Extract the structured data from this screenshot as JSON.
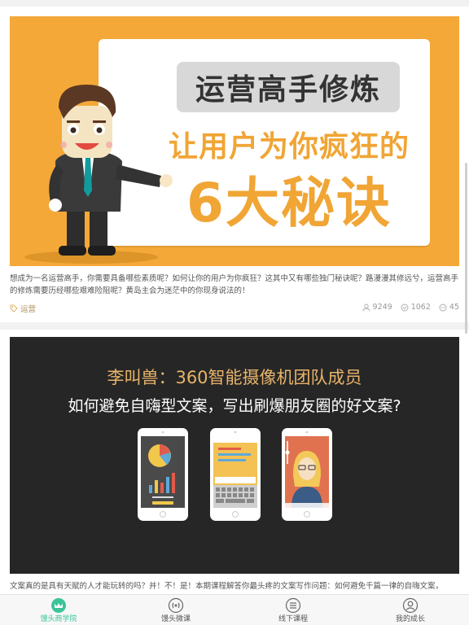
{
  "feed": {
    "cards": [
      {
        "banner_title": "运营高手修炼",
        "banner_line2": "让用户为你疯狂的",
        "banner_line3": "6大秘诀",
        "description": "想成为一名运营高手，你需要具备哪些素质呢？如何让你的用户为你疯狂？这其中又有哪些独门秘诀呢？路漫漫其修远兮，运营高手的修炼需要历经哪些艰难险阻呢？黄岛主会为迷茫中的你现身说法的！",
        "tag": "运营",
        "views": "9249",
        "likes": "1062",
        "comments": "45"
      },
      {
        "banner_line1": "李叫兽：360智能摄像机团队成员",
        "banner_line2": "如何避免自嗨型文案，写出刷爆朋友圈的好文案?",
        "description": "文案真的是具有天赋的人才能玩转的吗？并！不！是！本期课程解答你最头疼的文案写作问题：如何避免千篇一律的自嗨文案，"
      }
    ]
  },
  "tabbar": {
    "items": [
      {
        "label": "馒头商学院",
        "icon": "home-logo-icon",
        "active": true
      },
      {
        "label": "馒头微课",
        "icon": "microlesson-icon",
        "active": false
      },
      {
        "label": "线下课程",
        "icon": "list-icon",
        "active": false
      },
      {
        "label": "我的成长",
        "icon": "profile-icon",
        "active": false
      }
    ]
  },
  "colors": {
    "accent": "#3cc39a",
    "banner1_bg": "#f4a838",
    "banner2_bg": "#262626",
    "highlight_orange": "#f0a535"
  }
}
